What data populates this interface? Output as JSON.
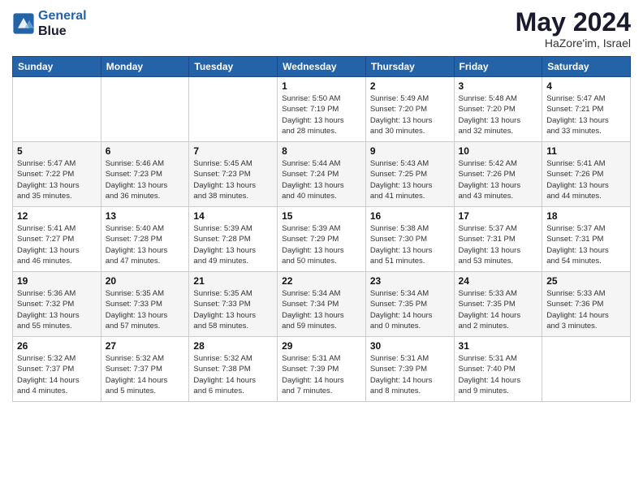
{
  "logo": {
    "line1": "General",
    "line2": "Blue"
  },
  "title": "May 2024",
  "subtitle": "HaZore'im, Israel",
  "days_of_week": [
    "Sunday",
    "Monday",
    "Tuesday",
    "Wednesday",
    "Thursday",
    "Friday",
    "Saturday"
  ],
  "weeks": [
    [
      {
        "day": "",
        "info": ""
      },
      {
        "day": "",
        "info": ""
      },
      {
        "day": "",
        "info": ""
      },
      {
        "day": "1",
        "info": "Sunrise: 5:50 AM\nSunset: 7:19 PM\nDaylight: 13 hours\nand 28 minutes."
      },
      {
        "day": "2",
        "info": "Sunrise: 5:49 AM\nSunset: 7:20 PM\nDaylight: 13 hours\nand 30 minutes."
      },
      {
        "day": "3",
        "info": "Sunrise: 5:48 AM\nSunset: 7:20 PM\nDaylight: 13 hours\nand 32 minutes."
      },
      {
        "day": "4",
        "info": "Sunrise: 5:47 AM\nSunset: 7:21 PM\nDaylight: 13 hours\nand 33 minutes."
      }
    ],
    [
      {
        "day": "5",
        "info": "Sunrise: 5:47 AM\nSunset: 7:22 PM\nDaylight: 13 hours\nand 35 minutes."
      },
      {
        "day": "6",
        "info": "Sunrise: 5:46 AM\nSunset: 7:23 PM\nDaylight: 13 hours\nand 36 minutes."
      },
      {
        "day": "7",
        "info": "Sunrise: 5:45 AM\nSunset: 7:23 PM\nDaylight: 13 hours\nand 38 minutes."
      },
      {
        "day": "8",
        "info": "Sunrise: 5:44 AM\nSunset: 7:24 PM\nDaylight: 13 hours\nand 40 minutes."
      },
      {
        "day": "9",
        "info": "Sunrise: 5:43 AM\nSunset: 7:25 PM\nDaylight: 13 hours\nand 41 minutes."
      },
      {
        "day": "10",
        "info": "Sunrise: 5:42 AM\nSunset: 7:26 PM\nDaylight: 13 hours\nand 43 minutes."
      },
      {
        "day": "11",
        "info": "Sunrise: 5:41 AM\nSunset: 7:26 PM\nDaylight: 13 hours\nand 44 minutes."
      }
    ],
    [
      {
        "day": "12",
        "info": "Sunrise: 5:41 AM\nSunset: 7:27 PM\nDaylight: 13 hours\nand 46 minutes."
      },
      {
        "day": "13",
        "info": "Sunrise: 5:40 AM\nSunset: 7:28 PM\nDaylight: 13 hours\nand 47 minutes."
      },
      {
        "day": "14",
        "info": "Sunrise: 5:39 AM\nSunset: 7:28 PM\nDaylight: 13 hours\nand 49 minutes."
      },
      {
        "day": "15",
        "info": "Sunrise: 5:39 AM\nSunset: 7:29 PM\nDaylight: 13 hours\nand 50 minutes."
      },
      {
        "day": "16",
        "info": "Sunrise: 5:38 AM\nSunset: 7:30 PM\nDaylight: 13 hours\nand 51 minutes."
      },
      {
        "day": "17",
        "info": "Sunrise: 5:37 AM\nSunset: 7:31 PM\nDaylight: 13 hours\nand 53 minutes."
      },
      {
        "day": "18",
        "info": "Sunrise: 5:37 AM\nSunset: 7:31 PM\nDaylight: 13 hours\nand 54 minutes."
      }
    ],
    [
      {
        "day": "19",
        "info": "Sunrise: 5:36 AM\nSunset: 7:32 PM\nDaylight: 13 hours\nand 55 minutes."
      },
      {
        "day": "20",
        "info": "Sunrise: 5:35 AM\nSunset: 7:33 PM\nDaylight: 13 hours\nand 57 minutes."
      },
      {
        "day": "21",
        "info": "Sunrise: 5:35 AM\nSunset: 7:33 PM\nDaylight: 13 hours\nand 58 minutes."
      },
      {
        "day": "22",
        "info": "Sunrise: 5:34 AM\nSunset: 7:34 PM\nDaylight: 13 hours\nand 59 minutes."
      },
      {
        "day": "23",
        "info": "Sunrise: 5:34 AM\nSunset: 7:35 PM\nDaylight: 14 hours\nand 0 minutes."
      },
      {
        "day": "24",
        "info": "Sunrise: 5:33 AM\nSunset: 7:35 PM\nDaylight: 14 hours\nand 2 minutes."
      },
      {
        "day": "25",
        "info": "Sunrise: 5:33 AM\nSunset: 7:36 PM\nDaylight: 14 hours\nand 3 minutes."
      }
    ],
    [
      {
        "day": "26",
        "info": "Sunrise: 5:32 AM\nSunset: 7:37 PM\nDaylight: 14 hours\nand 4 minutes."
      },
      {
        "day": "27",
        "info": "Sunrise: 5:32 AM\nSunset: 7:37 PM\nDaylight: 14 hours\nand 5 minutes."
      },
      {
        "day": "28",
        "info": "Sunrise: 5:32 AM\nSunset: 7:38 PM\nDaylight: 14 hours\nand 6 minutes."
      },
      {
        "day": "29",
        "info": "Sunrise: 5:31 AM\nSunset: 7:39 PM\nDaylight: 14 hours\nand 7 minutes."
      },
      {
        "day": "30",
        "info": "Sunrise: 5:31 AM\nSunset: 7:39 PM\nDaylight: 14 hours\nand 8 minutes."
      },
      {
        "day": "31",
        "info": "Sunrise: 5:31 AM\nSunset: 7:40 PM\nDaylight: 14 hours\nand 9 minutes."
      },
      {
        "day": "",
        "info": ""
      }
    ]
  ]
}
